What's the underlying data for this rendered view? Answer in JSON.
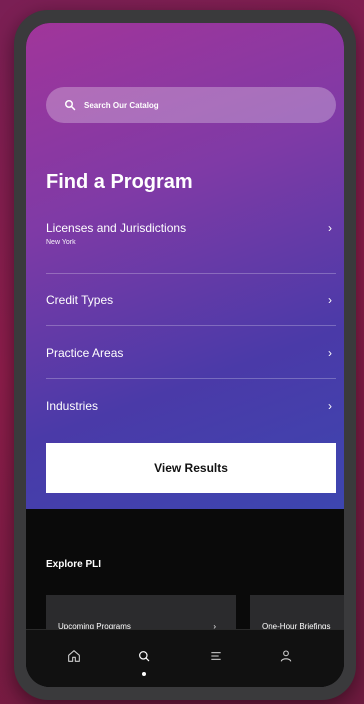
{
  "search": {
    "placeholder": "Search Our Catalog",
    "icon": "search-icon"
  },
  "main": {
    "title": "Find a Program",
    "filters": [
      {
        "label": "Licenses and Jurisdictions",
        "sub": "New York"
      },
      {
        "label": "Credit Types",
        "sub": ""
      },
      {
        "label": "Practice Areas",
        "sub": ""
      },
      {
        "label": "Industries",
        "sub": ""
      }
    ],
    "view_button": "View Results"
  },
  "explore": {
    "title": "Explore PLI",
    "cards": [
      {
        "label": "Upcoming Programs"
      },
      {
        "label": "One-Hour Briefings"
      }
    ]
  },
  "tabbar": {
    "items": [
      "home-icon",
      "search-icon",
      "menu-icon",
      "profile-icon"
    ],
    "active": "search-icon"
  }
}
